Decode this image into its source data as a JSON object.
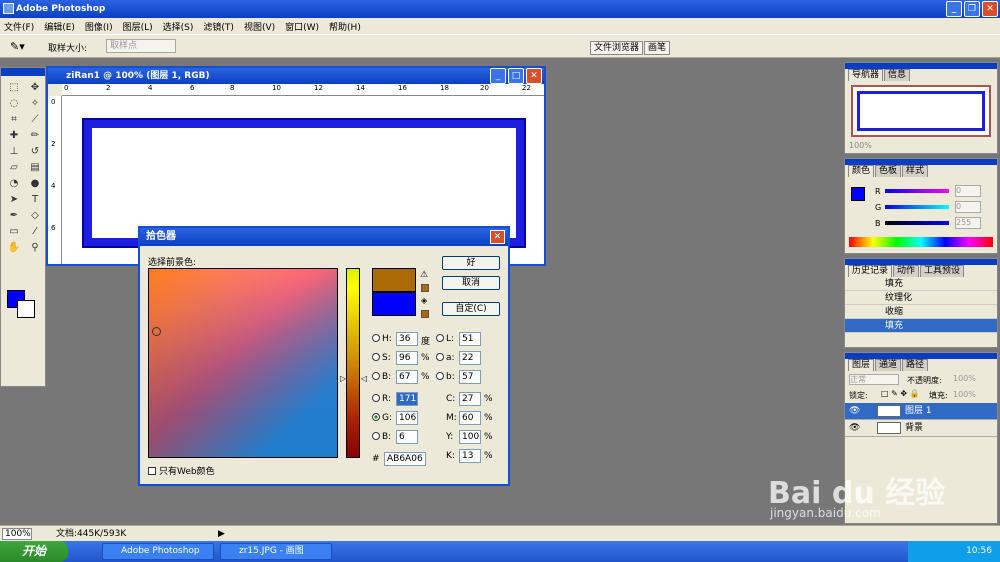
{
  "app": {
    "title": "Adobe Photoshop"
  },
  "menu": [
    "文件(F)",
    "编辑(E)",
    "图像(I)",
    "图层(L)",
    "选择(S)",
    "滤镜(T)",
    "视图(V)",
    "窗口(W)",
    "帮助(H)"
  ],
  "options": {
    "sample_size_label": "取样大小:",
    "sample_value": "取样点",
    "well_tabs": [
      "文件浏览器",
      "画笔"
    ]
  },
  "document": {
    "title": "ziRan1 @ 100% (图层 1, RGB)",
    "ruler_marks": [
      "0",
      "2",
      "4",
      "6",
      "8",
      "10",
      "12",
      "14",
      "16",
      "18",
      "20",
      "22"
    ],
    "vruler_marks": [
      "0",
      "2",
      "4",
      "6"
    ]
  },
  "picker": {
    "title": "拾色器",
    "select_label": "选择前景色:",
    "buttons": {
      "ok": "好",
      "cancel": "取消",
      "custom": "自定(C)"
    },
    "hsb": [
      {
        "label": "H:",
        "value": "36",
        "unit": "度"
      },
      {
        "label": "S:",
        "value": "96",
        "unit": "%"
      },
      {
        "label": "B:",
        "value": "67",
        "unit": "%"
      }
    ],
    "lab": [
      {
        "label": "L:",
        "value": "51"
      },
      {
        "label": "a:",
        "value": "22"
      },
      {
        "label": "b:",
        "value": "57"
      }
    ],
    "rgb": [
      {
        "label": "R:",
        "value": "171"
      },
      {
        "label": "G:",
        "value": "106"
      },
      {
        "label": "B:",
        "value": "6"
      }
    ],
    "cmyk": [
      {
        "label": "C:",
        "value": "27",
        "unit": "%"
      },
      {
        "label": "M:",
        "value": "60",
        "unit": "%"
      },
      {
        "label": "Y:",
        "value": "100",
        "unit": "%"
      },
      {
        "label": "K:",
        "value": "13",
        "unit": "%"
      }
    ],
    "hex_label": "#",
    "hex": "AB6A06",
    "web_only": "只有Web颜色",
    "new_color": "#ab6a06",
    "current_color": "#0000ff"
  },
  "navigator": {
    "tabs": [
      "导航器",
      "信息"
    ],
    "zoom": "100%"
  },
  "color_panel": {
    "tabs": [
      "颜色",
      "色板",
      "样式"
    ],
    "channels": [
      {
        "label": "R",
        "value": "0"
      },
      {
        "label": "G",
        "value": "0"
      },
      {
        "label": "B",
        "value": "255"
      }
    ]
  },
  "history": {
    "tabs": [
      "历史记录",
      "动作",
      "工具预设"
    ],
    "items": [
      "填充",
      "纹理化",
      "收缩",
      "填充"
    ]
  },
  "layers": {
    "tabs": [
      "图层",
      "通道",
      "路径"
    ],
    "blend": "正常",
    "opacity_label": "不透明度:",
    "opacity": "100%",
    "lock_label": "锁定:",
    "fill_label": "填充:",
    "fill": "100%",
    "items": [
      "图层 1",
      "背景"
    ]
  },
  "status": {
    "zoom": "100%",
    "doc": "文档:445K/593K"
  },
  "taskbar": {
    "start": "开始",
    "tasks": [
      "Adobe Photoshop",
      "zr15.JPG - 画图"
    ],
    "time": "10:56"
  },
  "watermark": {
    "brand": "Bai du 经验",
    "url": "jingyan.baidu.com"
  },
  "colors": {
    "accent": "#0a3cc4",
    "foreground": "#0000ff",
    "selection": "#316ac5"
  }
}
